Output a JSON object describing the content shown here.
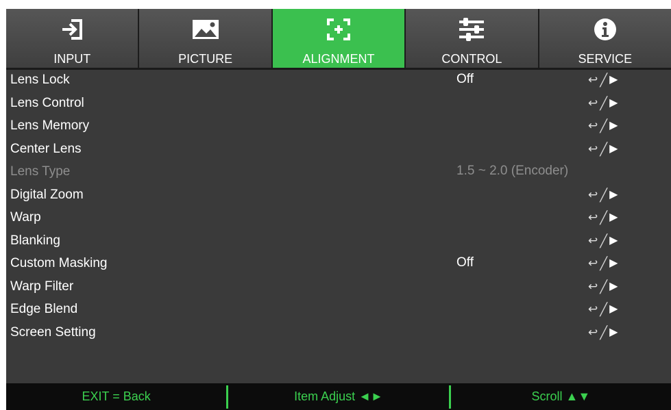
{
  "tabs": [
    {
      "label": "INPUT",
      "icon": "input-icon",
      "active": false
    },
    {
      "label": "PICTURE",
      "icon": "picture-icon",
      "active": false
    },
    {
      "label": "ALIGNMENT",
      "icon": "alignment-icon",
      "active": true
    },
    {
      "label": "CONTROL",
      "icon": "sliders-icon",
      "active": false
    },
    {
      "label": "SERVICE",
      "icon": "info-icon",
      "active": false
    }
  ],
  "menu": [
    {
      "name": "Lens Lock",
      "value": "Off",
      "action": true,
      "disabled": false
    },
    {
      "name": "Lens Control",
      "value": "",
      "action": true,
      "disabled": false
    },
    {
      "name": "Lens Memory",
      "value": "",
      "action": true,
      "disabled": false
    },
    {
      "name": "Center Lens",
      "value": "",
      "action": true,
      "disabled": false
    },
    {
      "name": "Lens Type",
      "value": "1.5 ~ 2.0 (Encoder)",
      "action": false,
      "disabled": true
    },
    {
      "name": "Digital Zoom",
      "value": "",
      "action": true,
      "disabled": false
    },
    {
      "name": "Warp",
      "value": "",
      "action": true,
      "disabled": false
    },
    {
      "name": "Blanking",
      "value": "",
      "action": true,
      "disabled": false
    },
    {
      "name": "Custom Masking",
      "value": "Off",
      "action": true,
      "disabled": false
    },
    {
      "name": "Warp Filter",
      "value": "",
      "action": true,
      "disabled": false
    },
    {
      "name": "Edge Blend",
      "value": "",
      "action": true,
      "disabled": false
    },
    {
      "name": "Screen Setting",
      "value": "",
      "action": true,
      "disabled": false
    }
  ],
  "action_glyphs": {
    "enter": "↩",
    "slash": "╱",
    "arrow": "▶"
  },
  "footer": {
    "exit": "EXIT = Back",
    "adjust": "Item Adjust ◄►",
    "scroll": "Scroll ▲▼"
  },
  "colors": {
    "active_tab": "#3bc04f",
    "footer_text": "#3bd04f",
    "background": "#3a3a3a"
  }
}
